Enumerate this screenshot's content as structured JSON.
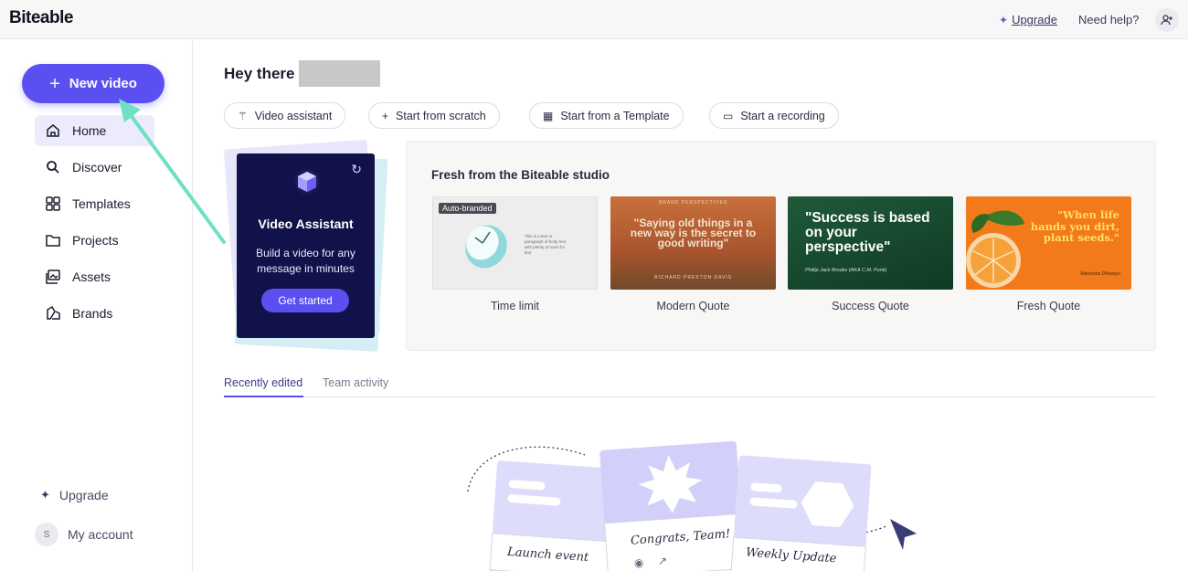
{
  "header": {
    "logo": "Biteable",
    "upgrade_label": "Upgrade",
    "help_label": "Need help?"
  },
  "sidebar": {
    "new_video_label": "New video",
    "items": [
      {
        "label": "Home",
        "icon": "home-icon",
        "active": true
      },
      {
        "label": "Discover",
        "icon": "search-icon",
        "active": false
      },
      {
        "label": "Templates",
        "icon": "grid-icon",
        "active": false
      },
      {
        "label": "Projects",
        "icon": "folder-icon",
        "active": false
      },
      {
        "label": "Assets",
        "icon": "image-stack-icon",
        "active": false
      },
      {
        "label": "Brands",
        "icon": "brand-icon",
        "active": false
      }
    ],
    "upgrade_label": "Upgrade",
    "account_initial": "S",
    "account_label": "My account"
  },
  "main": {
    "greeting": "Hey there",
    "actions": [
      {
        "label": "Video assistant",
        "icon": "magic-wand-icon"
      },
      {
        "label": "Start from scratch",
        "icon": "plus-icon"
      },
      {
        "label": "Start from a Template",
        "icon": "grid-icon"
      },
      {
        "label": "Start a recording",
        "icon": "camera-icon"
      }
    ],
    "assistant_card": {
      "title": "Video Assistant",
      "description": "Build a video for any message in minutes",
      "button": "Get started"
    },
    "studio": {
      "title": "Fresh from the Biteable studio",
      "templates": [
        {
          "label": "Time limit",
          "badge": "Auto-branded",
          "body_text": "This is a text or paragraph of body text with plenty of room for text"
        },
        {
          "label": "Modern Quote",
          "kicker": "BRAND PERSPECTIVES",
          "quote": "\"Saying old things in a new way is the secret to good writing\"",
          "author": "RICHARD PRESTON DAVIS"
        },
        {
          "label": "Success Quote",
          "quote": "\"Success is based on your perspective\"",
          "author": "Phillip Jack Brooks (AKA C.M. Punk)"
        },
        {
          "label": "Fresh Quote",
          "quote": "\"When life hands you dirt, plant seeds.\"",
          "author": "Matshona Dhliwayo"
        }
      ]
    },
    "tabs": [
      {
        "label": "Recently edited",
        "active": true
      },
      {
        "label": "Team activity",
        "active": false
      }
    ],
    "empty_state_cards": [
      "Launch event",
      "Congrats, Team!",
      "Weekly Update"
    ]
  },
  "colors": {
    "accent": "#5a4ff0",
    "assistant_bg": "#12124a",
    "arrow": "#6fe0c4"
  }
}
